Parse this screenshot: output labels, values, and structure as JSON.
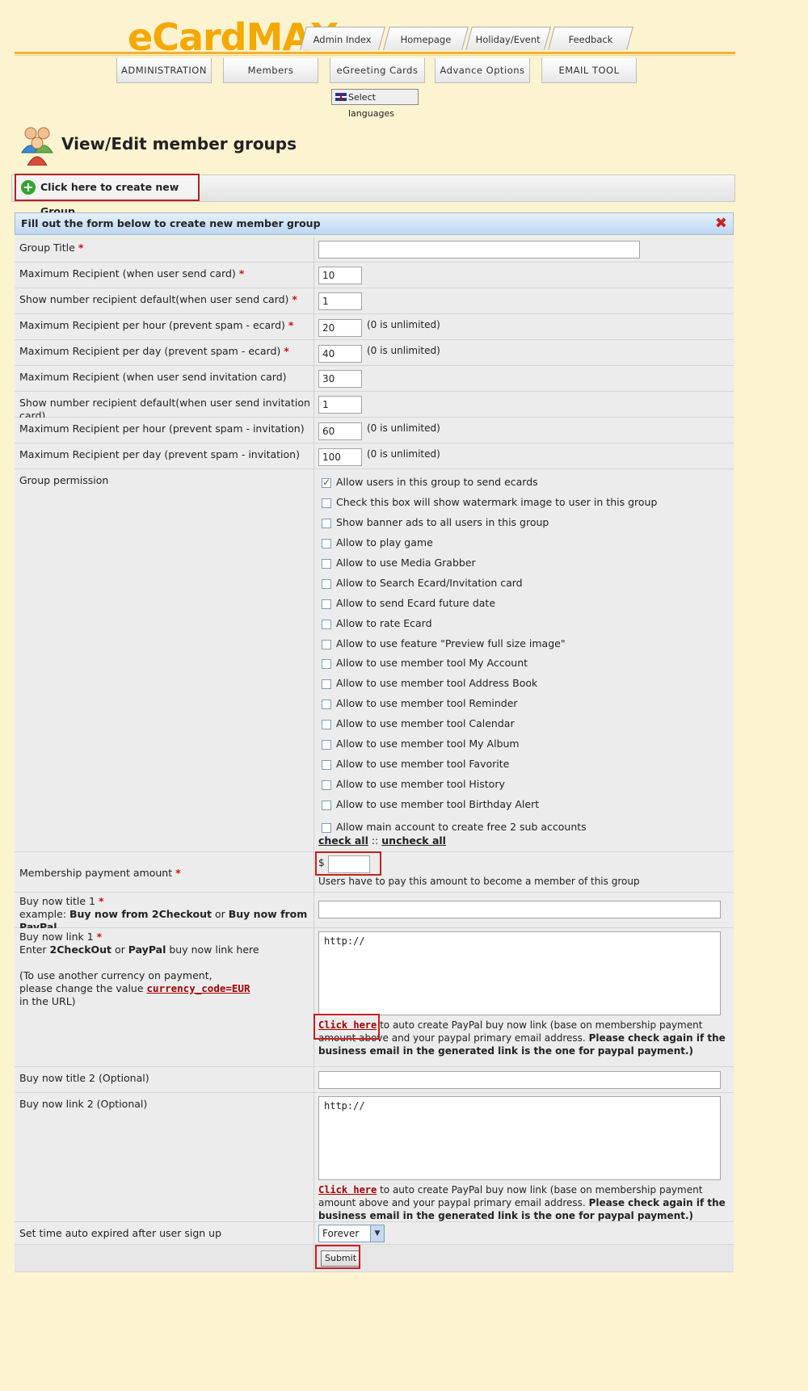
{
  "logo": {
    "text_e": "eCard",
    "text_max": "MAX"
  },
  "top_tabs": [
    "Admin Index",
    "Homepage",
    "Holiday/Event",
    "Feedback"
  ],
  "nav": [
    "ADMINISTRATION",
    "Members",
    "eGreeting Cards",
    "Advance Options",
    "EMAIL TOOL"
  ],
  "language_button": "Select languages",
  "page_title": "View/Edit member groups",
  "create_group": "Click here to create new Group",
  "form": {
    "header": "Fill out the form below to create new member group",
    "close_icon": "✖",
    "fields": [
      {
        "label": "Group Title",
        "value": ""
      },
      {
        "label": "Maximum Recipient (when user send card)",
        "value": "10"
      },
      {
        "label": "Show number recipient default(when user send card)",
        "value": "1"
      },
      {
        "label": "Maximum Recipient per hour (prevent spam - ecard)",
        "value": "20",
        "note": "(0 is unlimited)"
      },
      {
        "label": "Maximum Recipient per day (prevent spam - ecard)",
        "value": "40",
        "note": "(0 is unlimited)"
      },
      {
        "label": "Maximum Recipient (when user send invitation card)",
        "value": "30"
      },
      {
        "label": "Show number recipient default(when user send invitation card)",
        "value": "1"
      },
      {
        "label": "Maximum Recipient per hour (prevent spam - invitation)",
        "value": "60",
        "note": "(0 is unlimited)"
      },
      {
        "label": "Maximum Recipient per day (prevent spam - invitation)",
        "value": "100",
        "note": "(0 is unlimited)"
      }
    ],
    "permission_label": "Group permission",
    "permissions": [
      {
        "label": "Allow users in this group to send ecards",
        "checked": true
      },
      {
        "label": "Check this box will show watermark image to user in this group",
        "checked": false
      },
      {
        "label": "Show banner ads to all users in this group",
        "checked": false
      },
      {
        "label": "Allow to play game",
        "checked": false
      },
      {
        "label": "Allow to use Media Grabber",
        "checked": false
      },
      {
        "label": "Allow to Search Ecard/Invitation card",
        "checked": false
      },
      {
        "label": "Allow to send Ecard future date",
        "checked": false
      },
      {
        "label": "Allow to rate Ecard",
        "checked": false
      },
      {
        "label": "Allow to use feature \"Preview full size image\"",
        "checked": false
      },
      {
        "label": "Allow to use member tool My Account",
        "checked": false
      },
      {
        "label": "Allow to use member tool Address Book",
        "checked": false
      },
      {
        "label": "Allow to use member tool Reminder",
        "checked": false
      },
      {
        "label": "Allow to use member tool Calendar",
        "checked": false
      },
      {
        "label": "Allow to use member tool My Album",
        "checked": false
      },
      {
        "label": "Allow to use member tool Favorite",
        "checked": false
      },
      {
        "label": "Allow to use member tool History",
        "checked": false
      },
      {
        "label": "Allow to use member tool Birthday Alert",
        "checked": false
      },
      {
        "label": "Allow main account to create free 2 sub accounts",
        "checked": false
      }
    ],
    "check_all": "check all",
    "check_sep": "::",
    "uncheck_all": "uncheck all",
    "payment": {
      "label": "Membership payment amount",
      "currency": "$",
      "value": "",
      "help": "Users have to pay this amount to become a member of this group"
    },
    "buy_title_1": {
      "label": "Buy now title 1",
      "example_prefix": "example:",
      "example_a": "Buy now from 2Checkout",
      "example_or": "or",
      "example_b": "Buy now from PayPal",
      "value": ""
    },
    "buy_link_1": {
      "label": "Buy now link 1",
      "enter": "Enter",
      "enter_a": "2CheckOut",
      "enter_or": "or",
      "enter_b": "PayPal",
      "enter_rest": "buy now link here",
      "currency_note_1": "(To use another currency on payment,",
      "currency_note_2": "please change the value",
      "currency_code": "currency_code=EUR",
      "currency_note_3": "in the URL)",
      "value": "http://"
    },
    "click_here": "Click here",
    "autocreate_text": "to auto create PayPal buy now link (base on membership payment amount above and your paypal primary email address.",
    "autocreate_bold": "Please check again if the business email in the generated link is the one for paypal payment.)",
    "buy_title_2": {
      "label": "Buy now title 2 (Optional)",
      "value": ""
    },
    "buy_link_2": {
      "label": "Buy now link 2 (Optional)",
      "value": "http://"
    },
    "expire": {
      "label": "Set time auto expired after user sign up",
      "value": "Forever"
    },
    "submit": "Submit"
  },
  "colors": {
    "logo": "#f5a800",
    "accent_line": "#f2b135",
    "required": "#d01010",
    "link_red": "#a00000",
    "highlight_box": "#c81e1e",
    "form_header": "#bdd7f3"
  }
}
